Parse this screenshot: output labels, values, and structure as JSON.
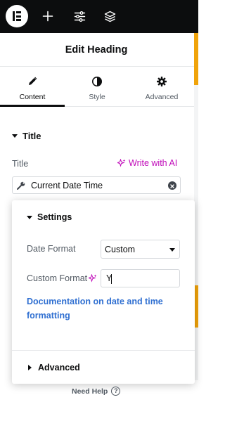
{
  "toolbar": {
    "logo_icon": "elementor-logo-icon",
    "items": [
      {
        "icon": "plus-icon"
      },
      {
        "icon": "sliders-icon"
      },
      {
        "icon": "layers-icon"
      }
    ]
  },
  "panel": {
    "title": "Edit Heading"
  },
  "tabs": [
    {
      "label": "Content",
      "icon": "pencil-icon",
      "active": true
    },
    {
      "label": "Style",
      "icon": "half-circle-icon",
      "active": false
    },
    {
      "label": "Advanced",
      "icon": "gear-icon",
      "active": false
    }
  ],
  "section": {
    "title": "Title",
    "field_label": "Title",
    "ai_link": "Write with AI",
    "input_value": "Current Date Time"
  },
  "popover": {
    "title": "Settings",
    "date_format_label": "Date Format",
    "date_format_value": "Custom",
    "custom_format_label": "Custom Format",
    "custom_format_value": "Y",
    "doc_link": "Documentation on date and time formatting",
    "advanced_label": "Advanced"
  },
  "footer": {
    "need_help": "Need Help"
  },
  "colors": {
    "toolbar_bg": "#0c0d0e",
    "accent_orange": "#f0a30a",
    "ai_magenta": "#c00bb9",
    "link_blue": "#2f6fd1"
  }
}
